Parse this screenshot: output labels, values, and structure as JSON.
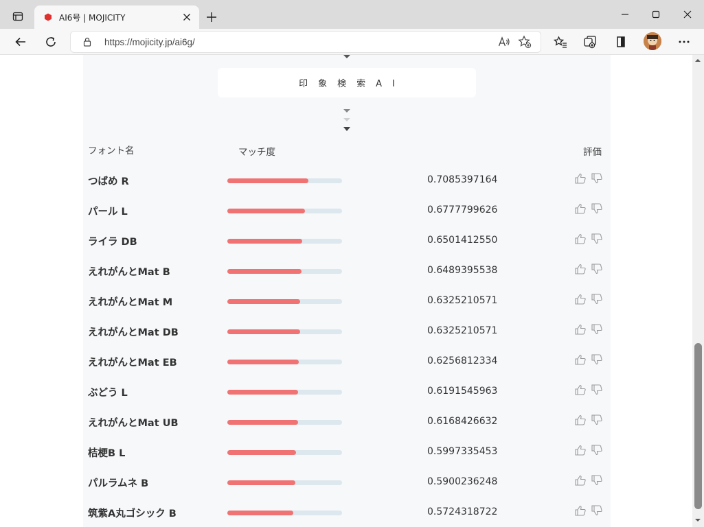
{
  "browser": {
    "tab_title": "AI6号 | MOJICITY",
    "url": "https://mojicity.jp/ai6g/",
    "favicon_color": "#e03131"
  },
  "page": {
    "search_button": "印象検索AI",
    "headers": {
      "font_name": "フォント名",
      "match": "マッチ度",
      "rating": "評価"
    },
    "bar_color": "#f07272",
    "track_color": "#dde7ee",
    "results": [
      {
        "name": "つばめ R",
        "score": "0.7085397164",
        "match": 0.7085397164
      },
      {
        "name": "パール L",
        "score": "0.6777799626",
        "match": 0.6777799626
      },
      {
        "name": "ライラ DB",
        "score": "0.6501412550",
        "match": 0.650141255
      },
      {
        "name": "えれがんとMat B",
        "score": "0.6489395538",
        "match": 0.6489395538
      },
      {
        "name": "えれがんとMat M",
        "score": "0.6325210571",
        "match": 0.6325210571
      },
      {
        "name": "えれがんとMat DB",
        "score": "0.6325210571",
        "match": 0.6325210571
      },
      {
        "name": "えれがんとMat EB",
        "score": "0.6256812334",
        "match": 0.6256812334
      },
      {
        "name": "ぶどう L",
        "score": "0.6191545963",
        "match": 0.6191545963
      },
      {
        "name": "えれがんとMat UB",
        "score": "0.6168426632",
        "match": 0.6168426632
      },
      {
        "name": "桔梗B L",
        "score": "0.5997335453",
        "match": 0.5997335453
      },
      {
        "name": "パルラムネ B",
        "score": "0.5900236248",
        "match": 0.5900236248
      },
      {
        "name": "筑紫A丸ゴシック B",
        "score": "0.5724318722",
        "match": 0.5724318722
      }
    ]
  }
}
